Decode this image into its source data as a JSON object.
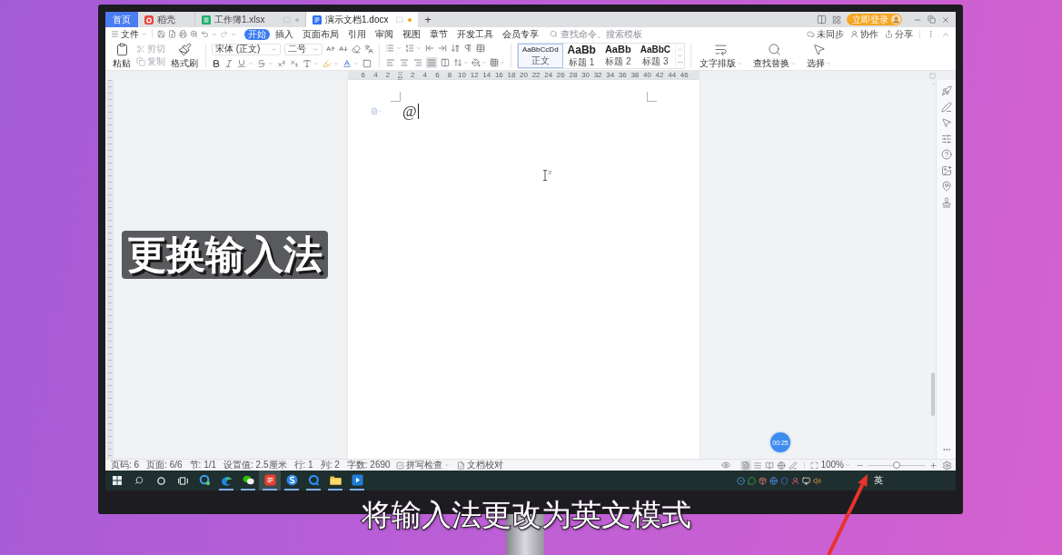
{
  "captions": {
    "title": "更换输入法",
    "subtitle": "将输入法更改为英文模式"
  },
  "tab_bar": {
    "tabs": [
      {
        "label": "首页",
        "kind": "home",
        "selected": false
      },
      {
        "label": "稻壳",
        "kind": "docer",
        "selected": false
      },
      {
        "label": "工作簿1.xlsx",
        "kind": "sheet",
        "selected": false,
        "modified": false
      },
      {
        "label": "演示文档1.docx",
        "kind": "writer",
        "selected": true,
        "modified": true
      }
    ],
    "new_tab": "+",
    "login": "立即登录"
  },
  "menu_bar": {
    "file": "文件",
    "tabs": [
      {
        "label": "开始",
        "selected": true
      },
      {
        "label": "插入",
        "selected": false
      },
      {
        "label": "页面布局",
        "selected": false
      },
      {
        "label": "引用",
        "selected": false
      },
      {
        "label": "审阅",
        "selected": false
      },
      {
        "label": "视图",
        "selected": false
      },
      {
        "label": "章节",
        "selected": false
      },
      {
        "label": "开发工具",
        "selected": false
      },
      {
        "label": "会员专享",
        "selected": false
      }
    ],
    "search": {
      "placeholder": "查找命令、搜索模板"
    },
    "actions": [
      {
        "label": "未同步",
        "kind": "sync"
      },
      {
        "label": "协作",
        "kind": "collaborate"
      },
      {
        "label": "分享",
        "kind": "share"
      }
    ]
  },
  "ribbon": {
    "clipboard": [
      {
        "label": "粘贴",
        "kind": "paste",
        "disabled": false
      },
      {
        "label": "剪切",
        "kind": "cut",
        "disabled": true
      },
      {
        "label": "复制",
        "kind": "copy",
        "disabled": true
      },
      {
        "label": "格式刷",
        "kind": "format_painter",
        "disabled": false
      }
    ],
    "font_family": "宋体 (正文)",
    "font_size": "二号",
    "alignment": [
      {
        "kind": "left",
        "selected": false
      },
      {
        "kind": "center",
        "selected": false
      },
      {
        "kind": "right",
        "selected": false
      },
      {
        "kind": "justify",
        "selected": true
      },
      {
        "kind": "distributed",
        "selected": false
      }
    ],
    "styles": [
      {
        "preview": "AaBbCcDd",
        "label": "正文",
        "kind": "body",
        "selected": true
      },
      {
        "preview": "AaBb",
        "label": "标题 1",
        "kind": "heading1",
        "selected": false
      },
      {
        "preview": "AaBb",
        "label": "标题 2",
        "kind": "heading2",
        "selected": false
      },
      {
        "preview": "AaBbC",
        "label": "标题 3",
        "kind": "heading3",
        "selected": false
      }
    ],
    "tools": [
      {
        "label": "文字排版",
        "kind": "layout"
      },
      {
        "label": "查找替换",
        "kind": "find"
      },
      {
        "label": "选择",
        "kind": "select"
      }
    ]
  },
  "ruler": {
    "left_marks": [
      "6",
      "4",
      "2"
    ],
    "marks": [
      "2",
      "4",
      "6",
      "8",
      "10",
      "12",
      "14",
      "16",
      "18",
      "20",
      "22",
      "24",
      "26",
      "28",
      "30",
      "32",
      "34",
      "36",
      "38",
      "40",
      "42",
      "44",
      "46"
    ]
  },
  "document": {
    "text": "@"
  },
  "recorder": {
    "time": "00:25"
  },
  "status_bar": {
    "items": [
      "页码: 6",
      "页面: 6/6",
      "节: 1/1",
      "设置值: 2.5厘米",
      "行: 1",
      "列: 2",
      "字数: 2690"
    ],
    "spell_check": "拼写检查",
    "proofread": "文档校对",
    "view_modes": [
      {
        "kind": "page",
        "selected": true
      },
      {
        "kind": "outline",
        "selected": false
      },
      {
        "kind": "reading",
        "selected": false
      },
      {
        "kind": "web",
        "selected": false
      },
      {
        "kind": "pen",
        "selected": false
      }
    ],
    "zoom": "100%",
    "zoom_slider": {
      "level": 0.5
    }
  },
  "taskbar": {
    "apps": [
      {
        "kind": "ring_browser",
        "selected": false,
        "running": false
      },
      {
        "kind": "wave_browser",
        "selected": false,
        "running": true
      },
      {
        "kind": "chat",
        "selected": false,
        "running": true
      },
      {
        "kind": "writer",
        "selected": true,
        "running": true
      },
      {
        "kind": "swirl",
        "selected": false,
        "running": true
      },
      {
        "kind": "ring_app",
        "selected": false,
        "running": true
      },
      {
        "kind": "folder",
        "selected": false,
        "running": true
      },
      {
        "kind": "player",
        "selected": false,
        "running": true
      }
    ],
    "ime": "英"
  }
}
